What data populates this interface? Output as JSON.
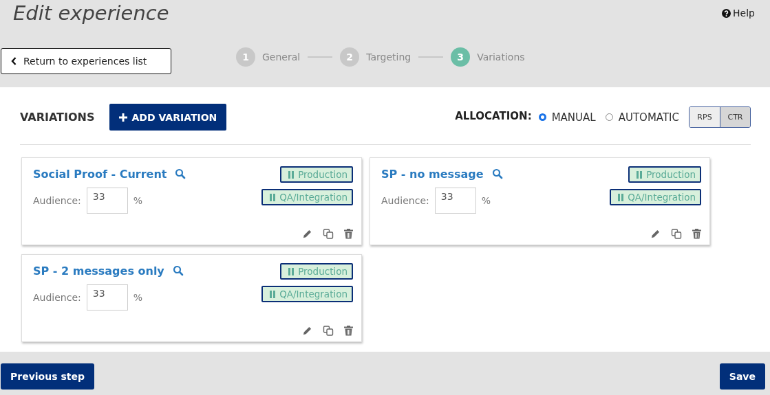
{
  "header": {
    "title": "Edit experience",
    "help": "Help",
    "back_button": "Return to experiences list"
  },
  "steps": [
    {
      "number": "1",
      "label": "General",
      "selected": false
    },
    {
      "number": "2",
      "label": "Targeting",
      "selected": false
    },
    {
      "number": "3",
      "label": "Variations",
      "selected": true
    }
  ],
  "toolbar": {
    "heading": "VARIATIONS",
    "add_button": "ADD VARIATION",
    "allocation_label": "ALLOCATION:",
    "allocation_options": [
      {
        "label": "MANUAL",
        "selected": true
      },
      {
        "label": "AUTOMATIC",
        "selected": false
      }
    ],
    "metric_toggle": [
      {
        "label": "RPS",
        "selected": false
      },
      {
        "label": "CTR",
        "selected": true
      }
    ]
  },
  "variations": [
    {
      "name": "Social Proof - Current",
      "audience_label": "Audience:",
      "audience": "33",
      "unit": "%",
      "environments": [
        "Production",
        "QA/Integration"
      ]
    },
    {
      "name": "SP - no message",
      "audience_label": "Audience:",
      "audience": "33",
      "unit": "%",
      "environments": [
        "Production",
        "QA/Integration"
      ]
    },
    {
      "name": "SP - 2 messages only",
      "audience_label": "Audience:",
      "audience": "33",
      "unit": "%",
      "environments": [
        "Production",
        "QA/Integration"
      ]
    }
  ],
  "footer": {
    "previous_button": "Previous step",
    "save_button": "Save"
  }
}
